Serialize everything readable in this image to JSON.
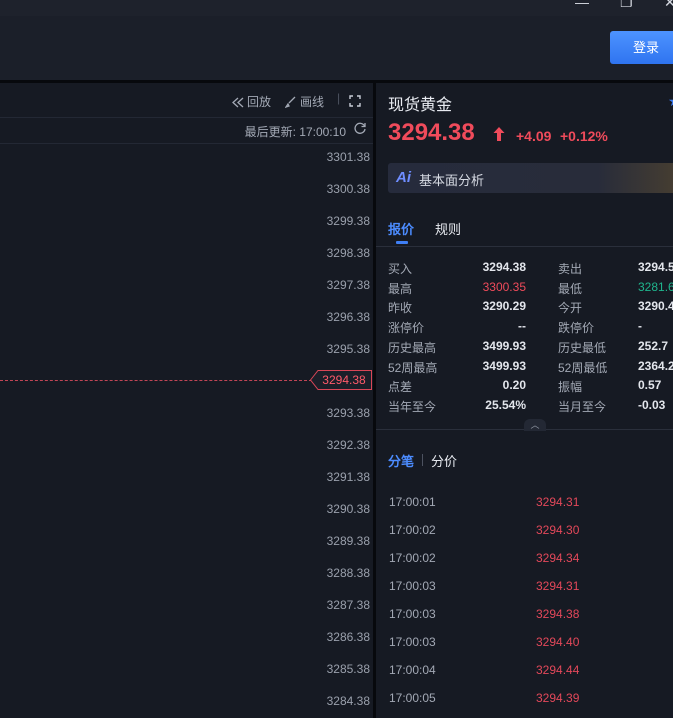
{
  "window": {
    "minimize_glyph": "—",
    "restore_glyph": "❐",
    "close_glyph": "✕"
  },
  "header": {
    "login_label": "登录"
  },
  "chart": {
    "toolbar": {
      "replay_label": "回放",
      "draw_label": "画线"
    },
    "last_update": "最后更新: 17:00:10",
    "price_ticks": [
      "3301.38",
      "3300.38",
      "3299.38",
      "3298.38",
      "3297.38",
      "3296.38",
      "3295.38",
      "3293.38",
      "3292.38",
      "3291.38",
      "3290.38",
      "3289.38",
      "3288.38",
      "3287.38",
      "3286.38",
      "3285.38",
      "3284.38"
    ],
    "current_price_tag": "3294.38",
    "colors": {
      "price_line": "#c24556",
      "grid": "#232834"
    }
  },
  "instrument": {
    "name": "现货黄金",
    "price": "3294.38",
    "change": "+4.09",
    "change_pct": "+0.12%",
    "ai_label": "基本面分析",
    "ai_logo": "Ai"
  },
  "tabs": {
    "quote": "报价",
    "rules": "规则"
  },
  "quote_rows": [
    {
      "l1": "买入",
      "v1": "3294.38",
      "l2": "卖出",
      "v2": "3294.5"
    },
    {
      "l1": "最高",
      "v1": "3300.35",
      "l2": "最低",
      "v2": "3281.6"
    },
    {
      "l1": "昨收",
      "v1": "3290.29",
      "l2": "今开",
      "v2": "3290.4"
    },
    {
      "l1": "涨停价",
      "v1": "--",
      "l2": "跌停价",
      "v2": "-"
    },
    {
      "l1": "历史最高",
      "v1": "3499.93",
      "l2": "历史最低",
      "v2": "252.7"
    },
    {
      "l1": "52周最高",
      "v1": "3499.93",
      "l2": "52周最低",
      "v2": "2364.2"
    },
    {
      "l1": "点差",
      "v1": "0.20",
      "l2": "振幅",
      "v2": "0.57"
    },
    {
      "l1": "当年至今",
      "v1": "25.54%",
      "l2": "当月至今",
      "v2": "-0.03"
    }
  ],
  "trade_tabs": {
    "ticks": "分笔",
    "minute": "分价"
  },
  "trades": [
    {
      "time": "17:00:01",
      "price": "3294.31"
    },
    {
      "time": "17:00:02",
      "price": "3294.30"
    },
    {
      "time": "17:00:02",
      "price": "3294.34"
    },
    {
      "time": "17:00:03",
      "price": "3294.31"
    },
    {
      "time": "17:00:03",
      "price": "3294.38"
    },
    {
      "time": "17:00:03",
      "price": "3294.40"
    },
    {
      "time": "17:00:04",
      "price": "3294.44"
    },
    {
      "time": "17:00:05",
      "price": "3294.39"
    }
  ],
  "colors": {
    "up": "#f04b5b",
    "down": "#1fb58d",
    "accent": "#3f7ff5"
  }
}
